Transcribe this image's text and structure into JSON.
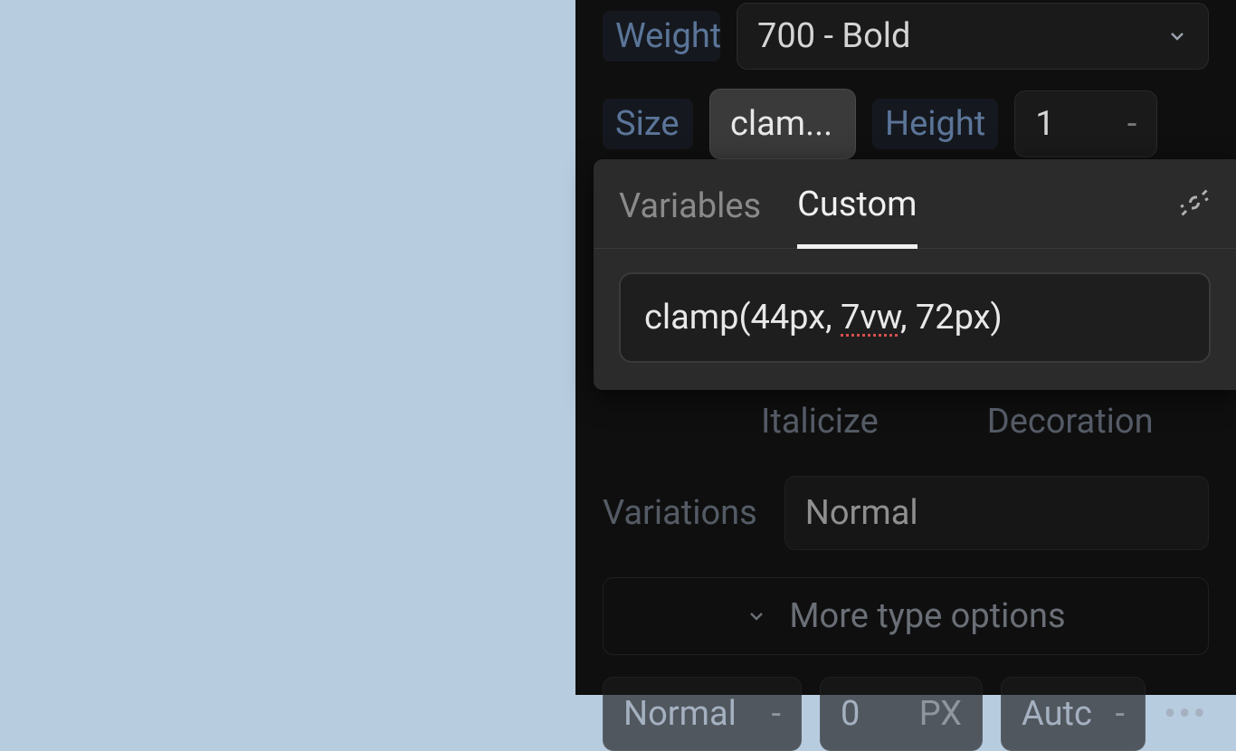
{
  "panel": {
    "weight": {
      "label": "Weight",
      "value": "700 - Bold"
    },
    "size": {
      "label": "Size",
      "value": "clam..."
    },
    "height": {
      "label": "Height",
      "value": "1",
      "unit": "-"
    },
    "italicize": "Italicize",
    "decoration": "Decoration",
    "variations": {
      "label": "Variations",
      "value": "Normal"
    },
    "moreOptions": "More type options",
    "bottom": {
      "first": {
        "value": "Normal",
        "unit": "-"
      },
      "second": {
        "value": "0",
        "unit": "PX"
      },
      "third": {
        "value": "Autc",
        "unit": "-"
      }
    }
  },
  "popover": {
    "tabs": {
      "variables": "Variables",
      "custom": "Custom"
    },
    "customValuePrefix": "clamp(44px, ",
    "customValueSpell": "7vw",
    "customValueSuffix": ", 72px)",
    "customValueFull": "clamp(44px, 7vw, 72px)"
  }
}
